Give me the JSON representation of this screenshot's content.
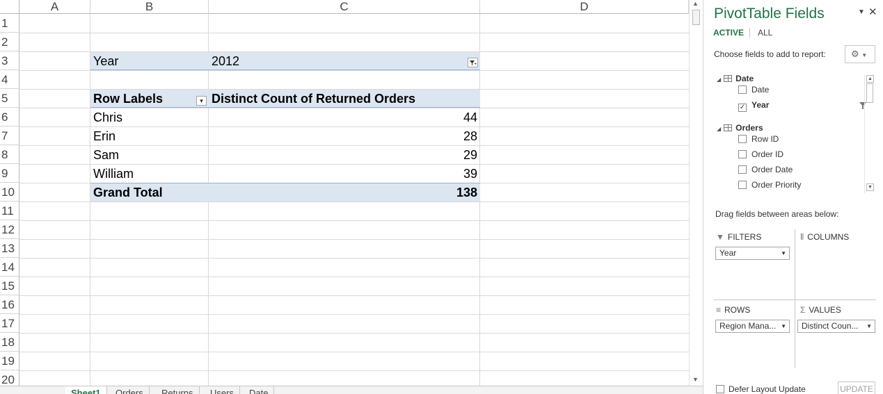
{
  "sheet": {
    "columns": [
      "A",
      "B",
      "C",
      "D"
    ],
    "rows": [
      "1",
      "2",
      "3",
      "4",
      "5",
      "6",
      "7",
      "8",
      "9",
      "10",
      "11",
      "12",
      "13",
      "14",
      "15",
      "16",
      "17",
      "18",
      "19",
      "20"
    ],
    "filter": {
      "label": "Year",
      "value": "2012"
    },
    "pivot": {
      "row_labels_header": "Row Labels",
      "value_header": "Distinct Count of Returned Orders",
      "rows": [
        {
          "label": "Chris",
          "value": "44"
        },
        {
          "label": "Erin",
          "value": "28"
        },
        {
          "label": "Sam",
          "value": "29"
        },
        {
          "label": "William",
          "value": "39"
        }
      ],
      "grand_total": {
        "label": "Grand Total",
        "value": "138"
      }
    },
    "tabs": [
      "Sheet1",
      "Orders",
      "Returns",
      "Users",
      "Date"
    ],
    "active_tab": "Sheet1"
  },
  "pane": {
    "title": "PivotTable Fields",
    "tabs": {
      "active": "ACTIVE",
      "all": "ALL"
    },
    "choose_label": "Choose fields to add to report:",
    "groups": [
      {
        "name": "Date",
        "fields": [
          {
            "name": "Date",
            "checked": false
          },
          {
            "name": "Year",
            "checked": true,
            "filtered": true
          }
        ]
      },
      {
        "name": "Orders",
        "fields": [
          {
            "name": "Row ID",
            "checked": false
          },
          {
            "name": "Order ID",
            "checked": false
          },
          {
            "name": "Order Date",
            "checked": false
          },
          {
            "name": "Order Priority",
            "checked": false
          }
        ]
      }
    ],
    "drag_label": "Drag fields between areas below:",
    "areas": {
      "filters": {
        "title": "FILTERS",
        "items": [
          "Year"
        ]
      },
      "columns": {
        "title": "COLUMNS",
        "items": []
      },
      "rows": {
        "title": "ROWS",
        "items": [
          "Region Mana..."
        ]
      },
      "values": {
        "title": "VALUES",
        "items": [
          "Distinct Coun..."
        ]
      }
    },
    "defer_label": "Defer Layout Update",
    "update_label": "UPDATE"
  },
  "colors": {
    "accent": "#217346",
    "pivot_band": "#dce6f1",
    "pivot_line": "#95b3d7"
  }
}
